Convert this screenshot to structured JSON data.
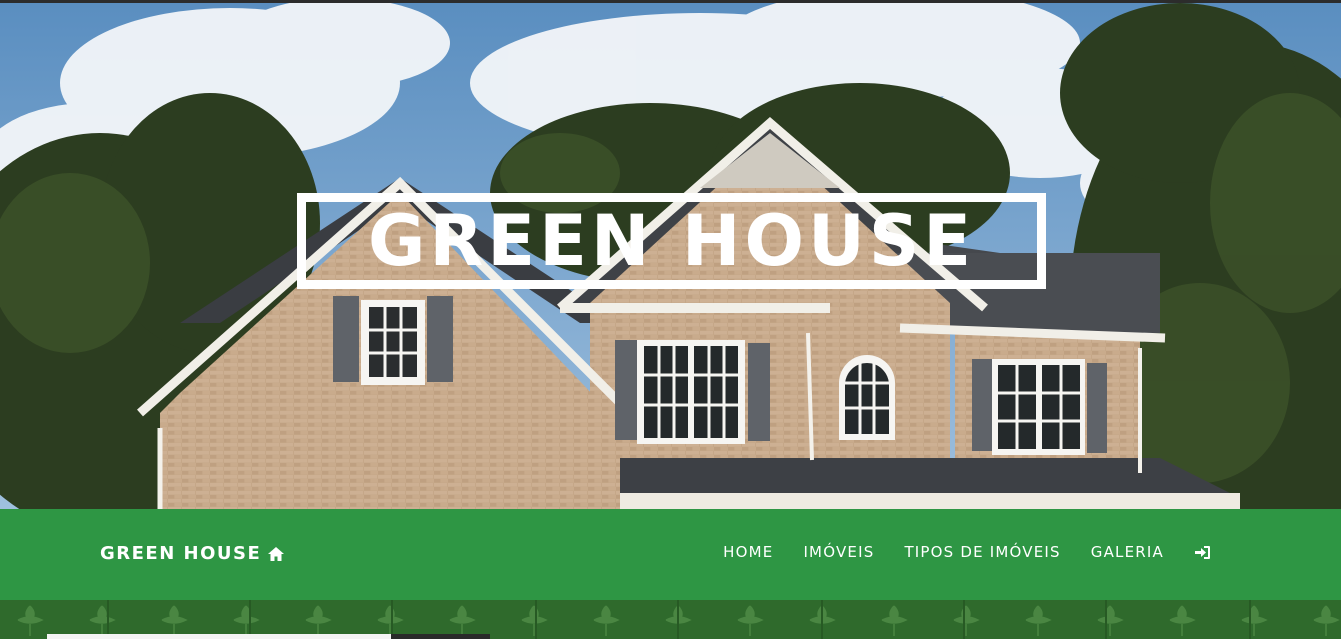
{
  "hero": {
    "title": "GREEN HOUSE"
  },
  "navbar": {
    "brand_label": "GREEN HOUSE",
    "brand_icon": "home-icon",
    "items": [
      {
        "label": "HOME"
      },
      {
        "label": "IMÓVEIS"
      },
      {
        "label": "TIPOS DE IMÓVEIS"
      },
      {
        "label": "GALERIA"
      }
    ],
    "login_icon": "sign-in-icon"
  },
  "colors": {
    "navbar": "#2e9644",
    "text": "#ffffff",
    "pattern": "#2f6a2c"
  }
}
